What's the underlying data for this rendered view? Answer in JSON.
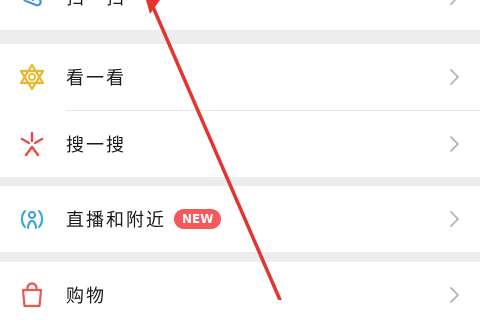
{
  "menu": {
    "scan": {
      "label": "扫一扫",
      "icon": "scan-icon"
    },
    "look": {
      "label": "看一看",
      "icon": "look-icon"
    },
    "search": {
      "label": "搜一搜",
      "icon": "search-sparkle-icon"
    },
    "live_nearby": {
      "label": "直播和附近",
      "icon": "live-nearby-icon",
      "badge": "NEW"
    },
    "shopping": {
      "label": "购物",
      "icon": "shopping-bag-icon"
    }
  },
  "colors": {
    "background": "#ededed",
    "row_background": "#ffffff",
    "badge": "#f45a5a",
    "annotation_arrow": "#e3342f",
    "chevron": "#b2b2b2"
  }
}
